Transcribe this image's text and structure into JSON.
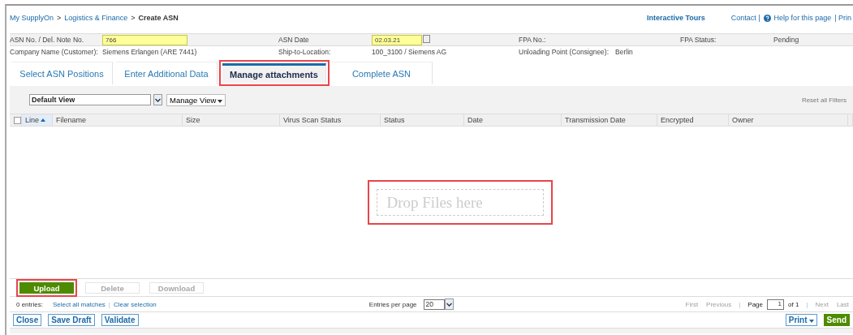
{
  "breadcrumb": [
    {
      "label": "My SupplyOn",
      "current": false
    },
    {
      "label": "Logistics & Finance",
      "current": false
    },
    {
      "label": "Create ASN",
      "current": true
    }
  ],
  "breadcrumb_separator": ">",
  "top_links": {
    "tours": "Interactive Tours",
    "contact": "Contact |",
    "help": "Help for this page",
    "print": "| Prin"
  },
  "header_fields": [
    {
      "label": "ASN No. / Del. Note No.",
      "value": "766",
      "kind": "input"
    },
    {
      "label": "ASN Date",
      "value": "02.03.21",
      "kind": "date"
    },
    {
      "label": "FPA No.:",
      "kind": "text"
    },
    {
      "label": "FPA Status:",
      "value": "Pending",
      "kind": "text"
    },
    {
      "label": "Company Name (Customer):",
      "value": "Siemens Erlangen (ARE 7441)",
      "kind": "text"
    },
    {
      "label": "Ship-to-Location:",
      "value": "100_3100 / Siemens AG",
      "kind": "text"
    },
    {
      "label": "Unloading Point (Consignee):",
      "value": "Berlin",
      "kind": "inline"
    }
  ],
  "tabs": [
    {
      "label": "Select ASN Positions",
      "selected": false,
      "highlighted": false
    },
    {
      "label": "Enter Additional Data",
      "selected": false,
      "highlighted": false
    },
    {
      "label": "Manage attachments",
      "selected": true,
      "highlighted": true
    },
    {
      "label": "Complete ASN",
      "selected": false,
      "highlighted": false
    }
  ],
  "view_select": {
    "value": "Default View"
  },
  "manage_view": "Manage View",
  "reset_filters": "Reset all Filters",
  "table": {
    "columns": [
      {
        "label": "Line",
        "sorted": true
      },
      {
        "label": "Filename",
        "sorted": false
      },
      {
        "label": "Size",
        "sorted": false
      },
      {
        "label": "Virus Scan Status",
        "sorted": false
      },
      {
        "label": "Status",
        "sorted": false
      },
      {
        "label": "Date",
        "sorted": false
      },
      {
        "label": "Transmission Date",
        "sorted": false
      },
      {
        "label": "Encrypted",
        "sorted": false
      },
      {
        "label": "Owner",
        "sorted": false
      }
    ],
    "select_all_checked": false
  },
  "drop_zone": {
    "text": "Drop Files here",
    "highlighted": true
  },
  "file_buttons": [
    {
      "label": "Upload",
      "disabled": false,
      "highlighted": true
    },
    {
      "label": "Delete",
      "disabled": true,
      "highlighted": false
    },
    {
      "label": "Download",
      "disabled": true,
      "highlighted": false
    }
  ],
  "status": {
    "entries": "0 entries:",
    "select_all": "Select all matches",
    "clear": "Clear selection",
    "divider": "|",
    "per_page_label": "Entries per page",
    "per_page": "20",
    "first": "First",
    "previous": "Previous",
    "page_label": "Page",
    "page": "1",
    "of": "of 1",
    "next": "Next",
    "last": "Last"
  },
  "footer_left": [
    "Close",
    "Save Draft",
    "Validate"
  ],
  "footer_right": [
    {
      "label": "Print",
      "kind": "menu"
    },
    {
      "label": "Send",
      "kind": "primary"
    }
  ]
}
